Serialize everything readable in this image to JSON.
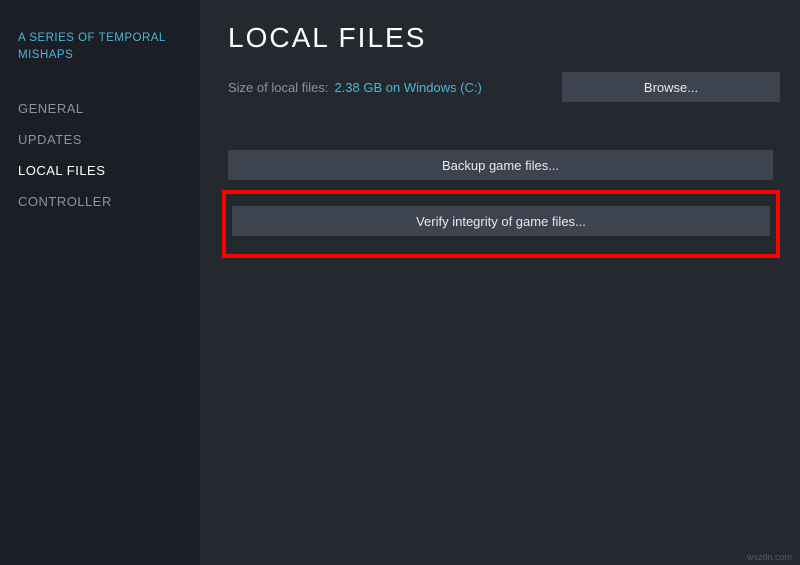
{
  "sidebar": {
    "game_title": "A SERIES OF TEMPORAL MISHAPS",
    "items": [
      {
        "label": "GENERAL"
      },
      {
        "label": "UPDATES"
      },
      {
        "label": "LOCAL FILES"
      },
      {
        "label": "CONTROLLER"
      }
    ],
    "active_index": 2
  },
  "main": {
    "title": "LOCAL FILES",
    "size_label": "Size of local files:",
    "size_value": "2.38 GB on Windows (C:)",
    "browse_label": "Browse...",
    "backup_label": "Backup game files...",
    "verify_label": "Verify integrity of game files..."
  },
  "close_glyph": "×",
  "watermark": "wszdn.com"
}
